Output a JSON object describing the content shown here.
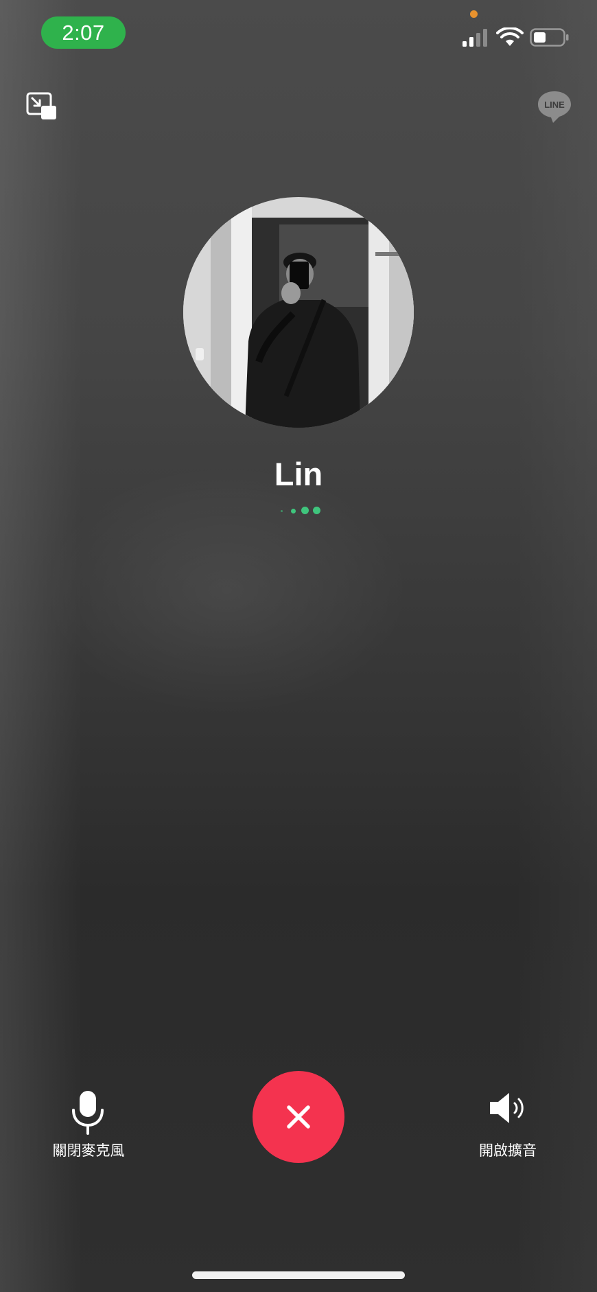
{
  "status_bar": {
    "time": "2:07",
    "time_pill_color": "#2fb24c",
    "privacy_dot_color": "#e8922e",
    "icons": [
      "signal-icon",
      "wifi-icon",
      "battery-icon"
    ]
  },
  "top_bar": {
    "left_icon": "picture-in-picture-icon",
    "right_logo": "LINE"
  },
  "call": {
    "caller_name": "Lin",
    "connecting_indicator_color": "#3fc57d"
  },
  "controls": {
    "mute": {
      "icon": "microphone-icon",
      "label": "關閉麥克風"
    },
    "end_call": {
      "icon": "close-icon",
      "color": "#f4334f"
    },
    "speaker": {
      "icon": "speaker-icon",
      "label": "開啟擴音"
    }
  }
}
